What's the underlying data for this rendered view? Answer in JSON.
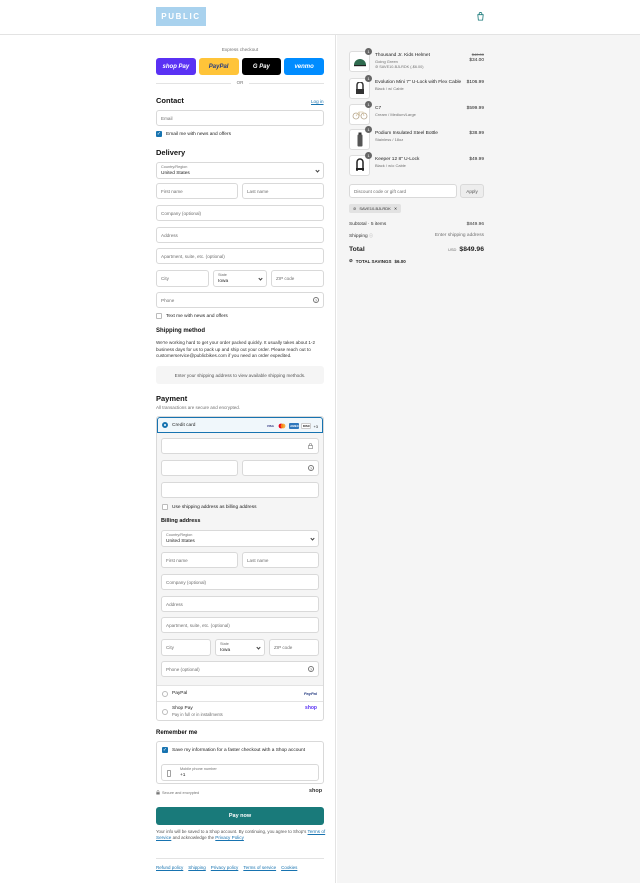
{
  "header": {
    "logo": "PUBLIC"
  },
  "express": {
    "title": "Express checkout",
    "or": "OR",
    "buttons": [
      {
        "label": "shop Pay",
        "bg": "#5a31f4",
        "fg": "#ffffff"
      },
      {
        "label": "PayPal",
        "bg": "#ffc439",
        "fg": "#253b80"
      },
      {
        "label": "G Pay",
        "bg": "#000000",
        "fg": "#ffffff"
      },
      {
        "label": "venmo",
        "bg": "#008cff",
        "fg": "#ffffff"
      }
    ]
  },
  "contact": {
    "heading": "Contact",
    "login": "Log in",
    "email_placeholder": "Email",
    "news_label": "Email me with news and offers"
  },
  "delivery": {
    "heading": "Delivery",
    "country_label": "Country/Region",
    "country": "United States",
    "first_name": "First name",
    "last_name": "Last name",
    "company": "Company (optional)",
    "address": "Address",
    "apartment": "Apartment, suite, etc. (optional)",
    "city": "City",
    "state_label": "State",
    "state": "Iowa",
    "zip": "ZIP code",
    "phone": "Phone",
    "text_label": "Text me with news and offers"
  },
  "shipping": {
    "heading": "Shipping method",
    "text": "We're working hard to get your order packed quickly. It usually takes about 1-2 business days for us to pack up and ship out your order. Please reach out to customerservice@publicbikes.com if you need an order expedited.",
    "notice": "Enter your shipping address to view available shipping methods."
  },
  "payment": {
    "heading": "Payment",
    "sub": "All transactions are secure and encrypted.",
    "credit": "Credit card",
    "more_cards": "+3",
    "billing_same": "Use shipping address as billing address",
    "billing_heading": "Billing address",
    "country_label": "Country/Region",
    "country": "United States",
    "first_name": "First name",
    "last_name": "Last name",
    "company": "Company (optional)",
    "address": "Address",
    "apartment": "Apartment, suite, etc. (optional)",
    "city": "City",
    "state_label": "State",
    "state": "Iowa",
    "zip": "ZIP code",
    "phone": "Phone (optional)",
    "paypal": "PayPal",
    "shop_pay": "Shop Pay",
    "shop_pay_sub": "Pay in full or in installments"
  },
  "remember": {
    "heading": "Remember me",
    "save_label": "Save my information for a faster checkout with a Shop account",
    "mobile_label": "Mobile phone number",
    "mobile_value": "+1",
    "secure": "Secure and encrypted",
    "shop": "shop"
  },
  "paynow": "Pay now",
  "legal": {
    "line1": "Your info will be saved to a Shop account. By continuing, you agree to Shop's",
    "tos": "Terms of Service",
    "and": "and acknowledge the",
    "privacy": "Privacy Policy"
  },
  "footer": [
    "Refund policy",
    "Shipping",
    "Privacy policy",
    "Terms of service",
    "Cookies"
  ],
  "cart": {
    "items": [
      {
        "name": "Thousand Jr. Kids Helmet",
        "variant": "Going Green",
        "discount": "SAVE10-BJLRDK (-$6.00)",
        "price": "$34.00",
        "original": "$40.00",
        "qty": "1"
      },
      {
        "name": "Evolution Mini 7\" U-Lock with Flex Cable",
        "variant": "Black / w/ Cable",
        "price": "$106.99",
        "qty": "1"
      },
      {
        "name": "C7",
        "variant": "Cream / Medium/Large",
        "price": "$599.99",
        "qty": "1"
      },
      {
        "name": "Podium Insulated Steel Bottle",
        "variant": "Stainless / 18oz",
        "price": "$38.99",
        "qty": "1"
      },
      {
        "name": "Keeper 12 8\" U-Lock",
        "variant": "Black / w/o Cable",
        "price": "$49.99",
        "qty": "1"
      }
    ],
    "discount_placeholder": "Discount code or gift card",
    "apply": "Apply",
    "code": "SAVE10-BJLRDK",
    "subtotal_label": "Subtotal · 5 items",
    "subtotal": "$849.96",
    "shipping_label": "Shipping",
    "shipping_value": "Enter shipping address",
    "total_label": "Total",
    "currency": "USD",
    "total": "$849.96",
    "savings_label": "TOTAL SAVINGS",
    "savings": "$6.00"
  }
}
